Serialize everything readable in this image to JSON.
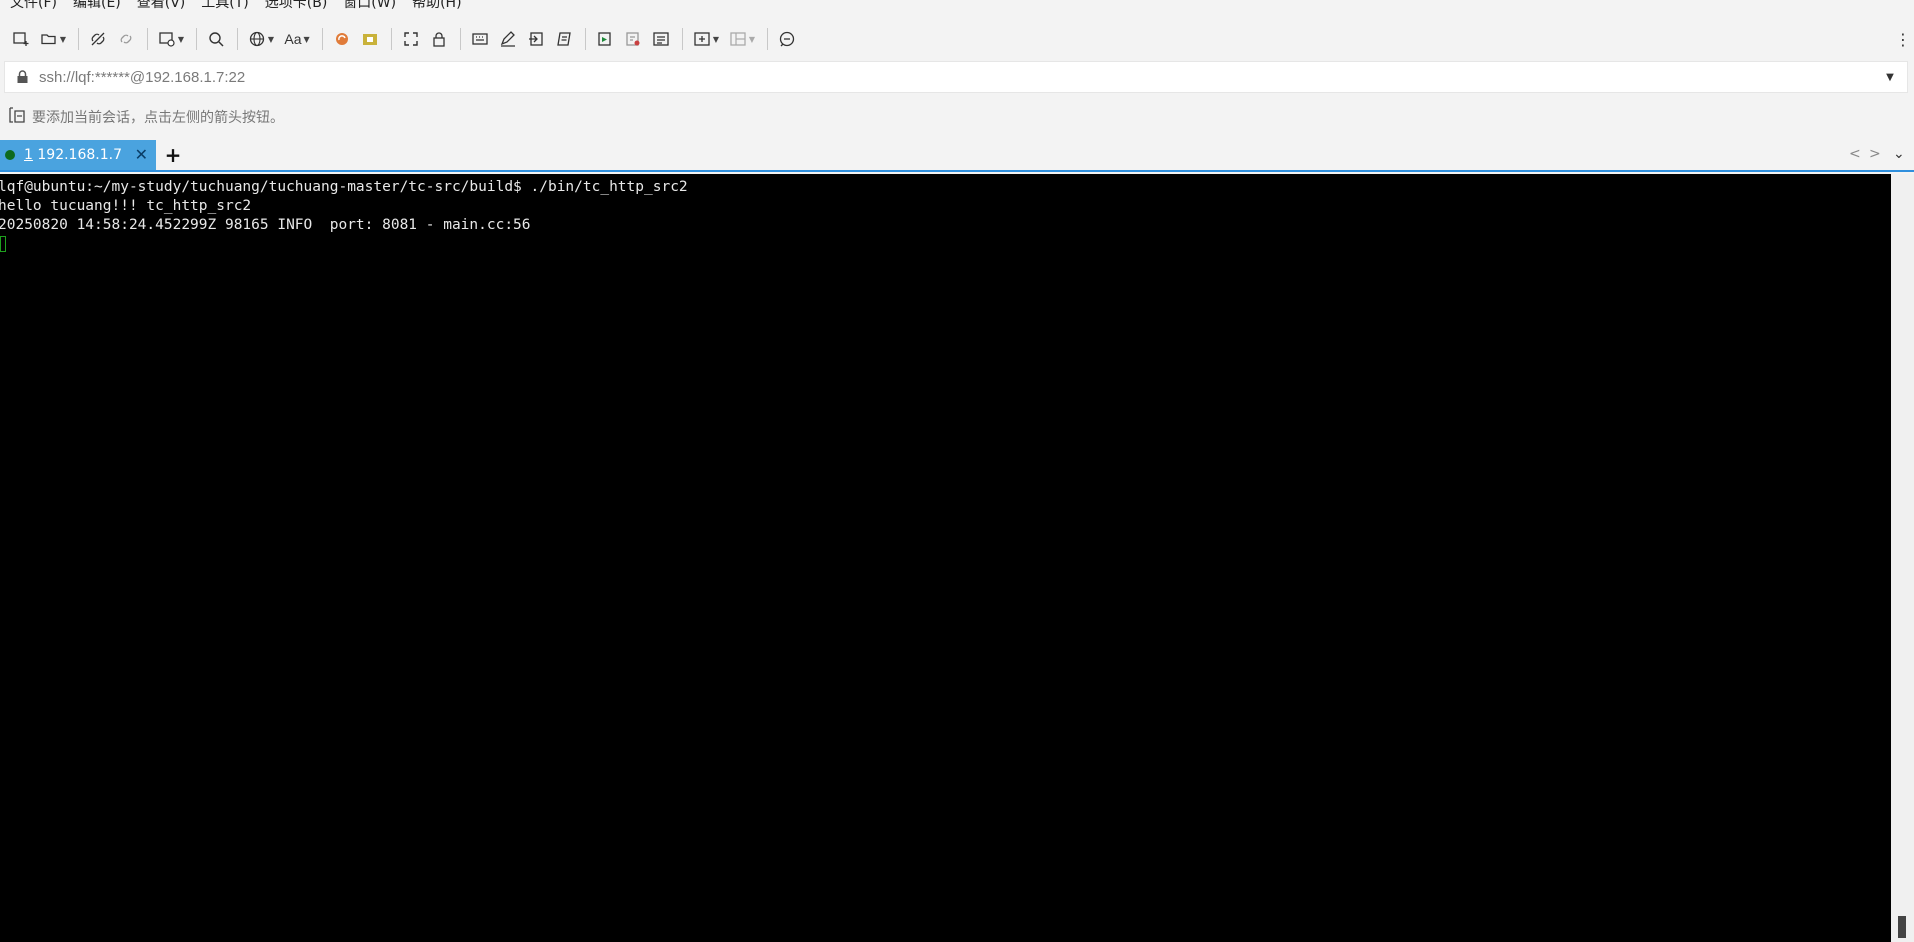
{
  "menubar": {
    "items": [
      "文件(F)",
      "编辑(E)",
      "查看(V)",
      "工具(T)",
      "选项卡(B)",
      "窗口(W)",
      "帮助(H)"
    ]
  },
  "toolbar": {
    "buttons": [
      "new-session-icon",
      "open-folder-icon",
      "disconnect-icon",
      "reconnect-icon",
      "new-tab-icon",
      "search-icon",
      "globe-icon",
      "font-icon",
      "xftp-icon",
      "xmanager-icon",
      "fullscreen-icon",
      "lock-icon",
      "keyboard-icon",
      "compose-icon",
      "send-icon",
      "script-icon",
      "log-icon",
      "transfer-icon",
      "notes-icon",
      "add-window-icon",
      "layout-icon",
      "chat-icon"
    ]
  },
  "address": {
    "value": "ssh://lqf:******@192.168.1.7:22"
  },
  "hint": {
    "text": "要添加当前会话，点击左侧的箭头按钮。"
  },
  "tabs": [
    {
      "index": "1",
      "label": "192.168.1.7",
      "status_color": "#0e6a1e",
      "active": true
    }
  ],
  "terminal": {
    "lines": [
      "lqf@ubuntu:~/my-study/tuchuang/tuchuang-master/tc-src/build$ ./bin/tc_http_src2",
      "hello tucuang!!! tc_http_src2",
      "20250820 14:58:24.452299Z 98165 INFO  port: 8081 - main.cc:56"
    ],
    "background": "#000000",
    "foreground": "#e8e8e8",
    "cursor_color": "#1ea01e"
  },
  "colors": {
    "tab_active": "#4aa3df",
    "tab_underline": "#2f8fdd"
  }
}
